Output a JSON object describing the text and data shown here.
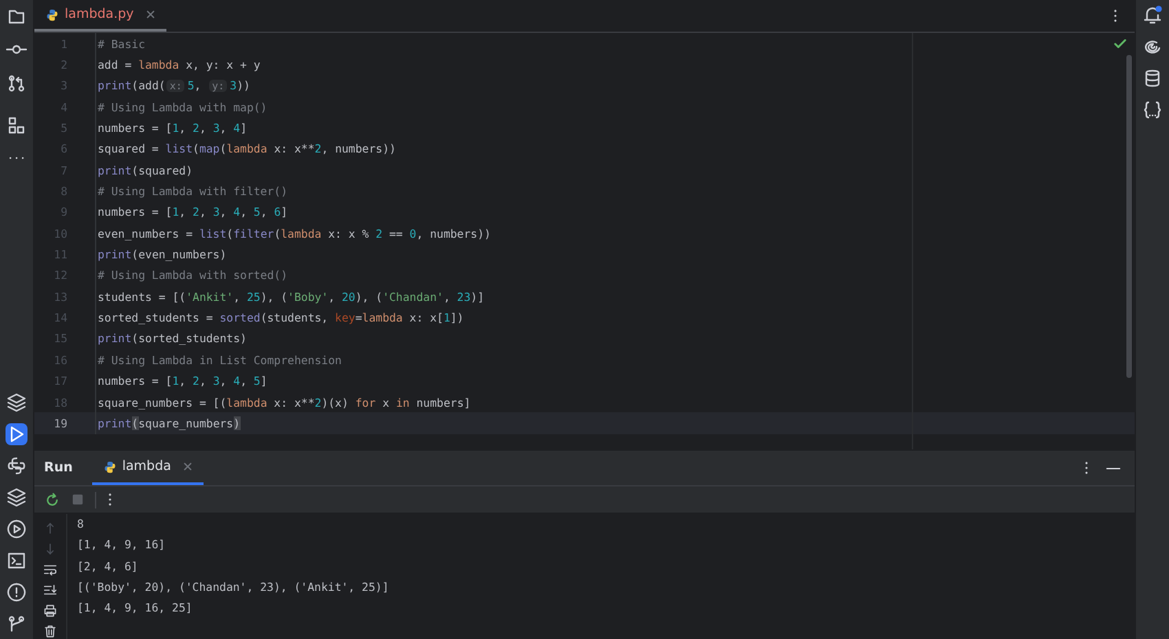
{
  "editor": {
    "tab": {
      "label": "lambda.py",
      "selected": true
    },
    "lines": [
      {
        "number": "1",
        "current": false,
        "tokens": [
          {
            "kind": "comment",
            "text": "# Basic"
          }
        ]
      },
      {
        "number": "2",
        "current": false,
        "tokens": [
          {
            "kind": "plain",
            "text": "add = "
          },
          {
            "kind": "keyword",
            "text": "lambda"
          },
          {
            "kind": "plain",
            "text": " x, y: x + y"
          }
        ]
      },
      {
        "number": "3",
        "current": false,
        "tokens": [
          {
            "kind": "builtin",
            "text": "print"
          },
          {
            "kind": "plain",
            "text": "(add("
          },
          {
            "kind": "hint",
            "text": "x:"
          },
          {
            "kind": "number",
            "text": "5"
          },
          {
            "kind": "plain",
            "text": ", "
          },
          {
            "kind": "hint",
            "text": "y:"
          },
          {
            "kind": "number",
            "text": "3"
          },
          {
            "kind": "plain",
            "text": "))"
          }
        ]
      },
      {
        "number": "4",
        "current": false,
        "tokens": [
          {
            "kind": "comment",
            "text": "# Using Lambda with map()"
          }
        ]
      },
      {
        "number": "5",
        "current": false,
        "tokens": [
          {
            "kind": "plain",
            "text": "numbers = ["
          },
          {
            "kind": "number",
            "text": "1"
          },
          {
            "kind": "plain",
            "text": ", "
          },
          {
            "kind": "number",
            "text": "2"
          },
          {
            "kind": "plain",
            "text": ", "
          },
          {
            "kind": "number",
            "text": "3"
          },
          {
            "kind": "plain",
            "text": ", "
          },
          {
            "kind": "number",
            "text": "4"
          },
          {
            "kind": "plain",
            "text": "]"
          }
        ]
      },
      {
        "number": "6",
        "current": false,
        "tokens": [
          {
            "kind": "plain",
            "text": "squared = "
          },
          {
            "kind": "builtin",
            "text": "list"
          },
          {
            "kind": "plain",
            "text": "("
          },
          {
            "kind": "builtin",
            "text": "map"
          },
          {
            "kind": "plain",
            "text": "("
          },
          {
            "kind": "keyword",
            "text": "lambda"
          },
          {
            "kind": "plain",
            "text": " x: x**"
          },
          {
            "kind": "number",
            "text": "2"
          },
          {
            "kind": "plain",
            "text": ", numbers))"
          }
        ]
      },
      {
        "number": "7",
        "current": false,
        "tokens": [
          {
            "kind": "builtin",
            "text": "print"
          },
          {
            "kind": "plain",
            "text": "(squared)"
          }
        ]
      },
      {
        "number": "8",
        "current": false,
        "tokens": [
          {
            "kind": "comment",
            "text": "# Using Lambda with filter()"
          }
        ]
      },
      {
        "number": "9",
        "current": false,
        "tokens": [
          {
            "kind": "plain",
            "text": "numbers = ["
          },
          {
            "kind": "number",
            "text": "1"
          },
          {
            "kind": "plain",
            "text": ", "
          },
          {
            "kind": "number",
            "text": "2"
          },
          {
            "kind": "plain",
            "text": ", "
          },
          {
            "kind": "number",
            "text": "3"
          },
          {
            "kind": "plain",
            "text": ", "
          },
          {
            "kind": "number",
            "text": "4"
          },
          {
            "kind": "plain",
            "text": ", "
          },
          {
            "kind": "number",
            "text": "5"
          },
          {
            "kind": "plain",
            "text": ", "
          },
          {
            "kind": "number",
            "text": "6"
          },
          {
            "kind": "plain",
            "text": "]"
          }
        ]
      },
      {
        "number": "10",
        "current": false,
        "tokens": [
          {
            "kind": "plain",
            "text": "even_numbers = "
          },
          {
            "kind": "builtin",
            "text": "list"
          },
          {
            "kind": "plain",
            "text": "("
          },
          {
            "kind": "builtin",
            "text": "filter"
          },
          {
            "kind": "plain",
            "text": "("
          },
          {
            "kind": "keyword",
            "text": "lambda"
          },
          {
            "kind": "plain",
            "text": " x: x % "
          },
          {
            "kind": "number",
            "text": "2"
          },
          {
            "kind": "plain",
            "text": " == "
          },
          {
            "kind": "number",
            "text": "0"
          },
          {
            "kind": "plain",
            "text": ", numbers))"
          }
        ]
      },
      {
        "number": "11",
        "current": false,
        "tokens": [
          {
            "kind": "builtin",
            "text": "print"
          },
          {
            "kind": "plain",
            "text": "(even_numbers)"
          }
        ]
      },
      {
        "number": "12",
        "current": false,
        "tokens": [
          {
            "kind": "comment",
            "text": "# Using Lambda with sorted()"
          }
        ]
      },
      {
        "number": "13",
        "current": false,
        "tokens": [
          {
            "kind": "plain",
            "text": "students = [("
          },
          {
            "kind": "string",
            "text": "'Ankit'"
          },
          {
            "kind": "plain",
            "text": ", "
          },
          {
            "kind": "number",
            "text": "25"
          },
          {
            "kind": "plain",
            "text": "), ("
          },
          {
            "kind": "string",
            "text": "'Boby'"
          },
          {
            "kind": "plain",
            "text": ", "
          },
          {
            "kind": "number",
            "text": "20"
          },
          {
            "kind": "plain",
            "text": "), ("
          },
          {
            "kind": "string",
            "text": "'Chandan'"
          },
          {
            "kind": "plain",
            "text": ", "
          },
          {
            "kind": "number",
            "text": "23"
          },
          {
            "kind": "plain",
            "text": ")]"
          }
        ]
      },
      {
        "number": "14",
        "current": false,
        "tokens": [
          {
            "kind": "plain",
            "text": "sorted_students = "
          },
          {
            "kind": "builtin",
            "text": "sorted"
          },
          {
            "kind": "plain",
            "text": "(students, "
          },
          {
            "kind": "param",
            "text": "key"
          },
          {
            "kind": "plain",
            "text": "="
          },
          {
            "kind": "keyword",
            "text": "lambda"
          },
          {
            "kind": "plain",
            "text": " x: x["
          },
          {
            "kind": "number",
            "text": "1"
          },
          {
            "kind": "plain",
            "text": "])"
          }
        ]
      },
      {
        "number": "15",
        "current": false,
        "tokens": [
          {
            "kind": "builtin",
            "text": "print"
          },
          {
            "kind": "plain",
            "text": "(sorted_students)"
          }
        ]
      },
      {
        "number": "16",
        "current": false,
        "tokens": [
          {
            "kind": "comment",
            "text": "# Using Lambda in List Comprehension"
          }
        ]
      },
      {
        "number": "17",
        "current": false,
        "tokens": [
          {
            "kind": "plain",
            "text": "numbers = ["
          },
          {
            "kind": "number",
            "text": "1"
          },
          {
            "kind": "plain",
            "text": ", "
          },
          {
            "kind": "number",
            "text": "2"
          },
          {
            "kind": "plain",
            "text": ", "
          },
          {
            "kind": "number",
            "text": "3"
          },
          {
            "kind": "plain",
            "text": ", "
          },
          {
            "kind": "number",
            "text": "4"
          },
          {
            "kind": "plain",
            "text": ", "
          },
          {
            "kind": "number",
            "text": "5"
          },
          {
            "kind": "plain",
            "text": "]"
          }
        ]
      },
      {
        "number": "18",
        "current": false,
        "tokens": [
          {
            "kind": "plain",
            "text": "square_numbers = [("
          },
          {
            "kind": "keyword",
            "text": "lambda"
          },
          {
            "kind": "plain",
            "text": " x: x**"
          },
          {
            "kind": "number",
            "text": "2"
          },
          {
            "kind": "plain",
            "text": ")(x) "
          },
          {
            "kind": "keyword",
            "text": "for"
          },
          {
            "kind": "plain",
            "text": " x "
          },
          {
            "kind": "keyword",
            "text": "in"
          },
          {
            "kind": "plain",
            "text": " numbers]"
          }
        ]
      },
      {
        "number": "19",
        "current": true,
        "tokens": [
          {
            "kind": "builtin",
            "text": "print"
          },
          {
            "kind": "brace-match",
            "text": "("
          },
          {
            "kind": "plain",
            "text": "square_numbers"
          },
          {
            "kind": "brace-match",
            "text": ")"
          }
        ]
      }
    ]
  },
  "left_toolbar": {
    "bottom": [
      {
        "selected": false
      },
      {
        "selected": true
      },
      {
        "selected": false
      },
      {
        "selected": false
      },
      {
        "selected": false
      },
      {
        "selected": false
      },
      {
        "selected": false
      },
      {
        "selected": false
      }
    ]
  },
  "notifications": {
    "unread": true
  },
  "run_panel": {
    "title": "Run",
    "tab": {
      "label": "lambda",
      "selected": true
    },
    "output": [
      "8",
      "[1, 4, 9, 16]",
      "[2, 4, 6]",
      "[('Boby', 20), ('Chandan', 23), ('Ankit', 25)]",
      "[1, 4, 9, 16, 25]"
    ]
  }
}
